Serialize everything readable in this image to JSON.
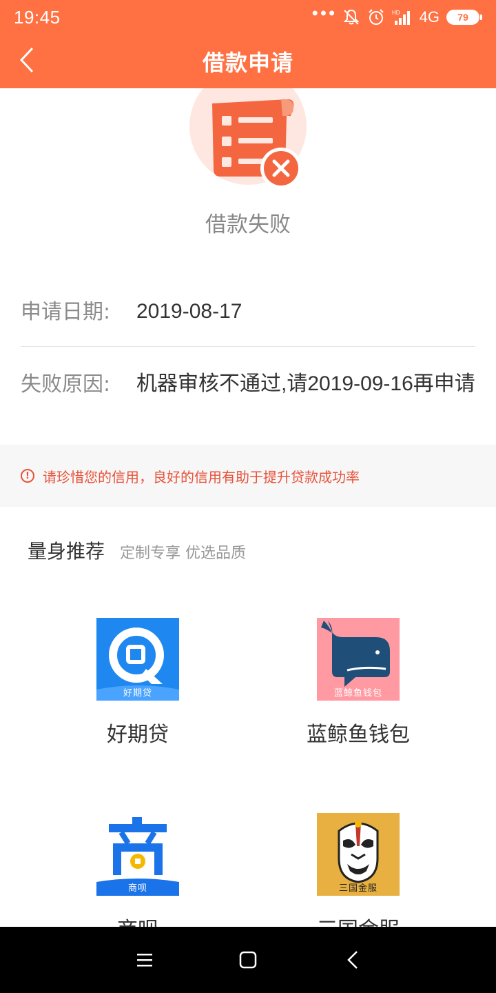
{
  "status_bar": {
    "time": "19:45",
    "network": "4G",
    "battery": "79"
  },
  "header": {
    "title": "借款申请"
  },
  "result": {
    "status": "借款失败"
  },
  "details": {
    "date_label": "申请日期:",
    "date_value": "2019-08-17",
    "reason_label": "失败原因:",
    "reason_value": "机器审核不通过,请2019-09-16再申请"
  },
  "tip": {
    "icon": "!",
    "text": "请珍惜您的信用，良好的信用有助于提升贷款成功率"
  },
  "recommend": {
    "title": "量身推荐",
    "subtitle": "定制专享 优选品质",
    "items": [
      {
        "name": "好期贷",
        "logo_caption": "好期贷",
        "color": "#1e88f0"
      },
      {
        "name": "蓝鲸鱼钱包",
        "logo_caption": "蓝鲸鱼钱包",
        "color": "#ff9aa2"
      },
      {
        "name": "商呗",
        "logo_caption": "商呗",
        "color": "#1a73e8"
      },
      {
        "name": "三国金服",
        "logo_caption": "三国金服",
        "color": "#e8b040"
      }
    ]
  },
  "theme": {
    "primary": "#ff7043",
    "warning": "#e8523a"
  }
}
